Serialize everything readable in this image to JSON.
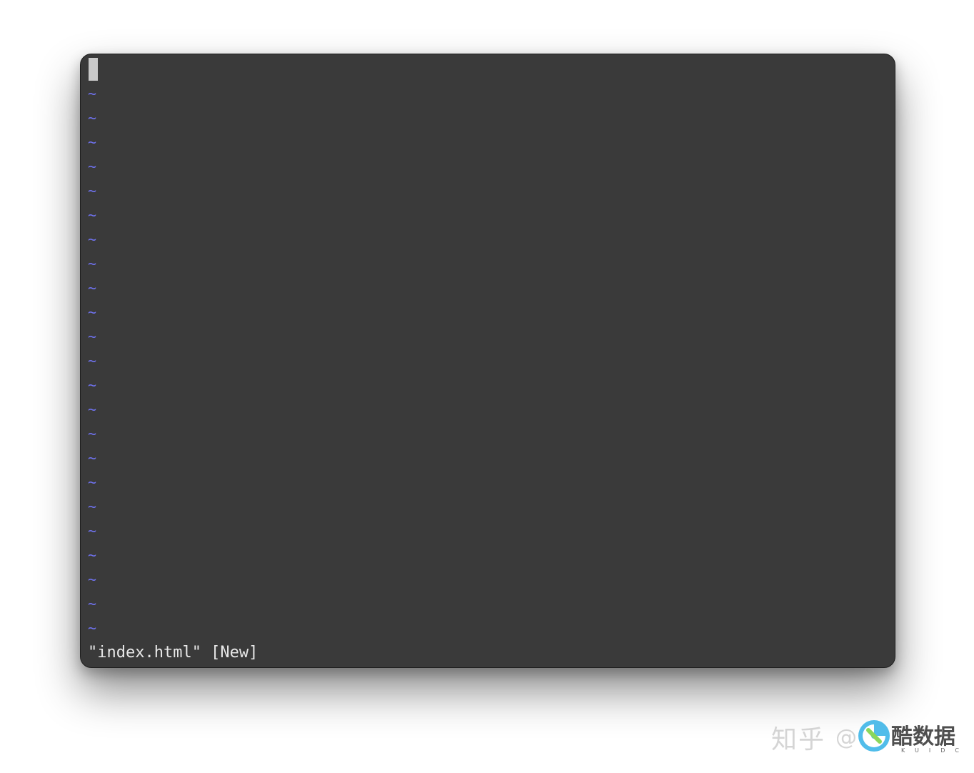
{
  "editor": {
    "empty_line_marker": "~",
    "status_message": "\"index.html\" [New]"
  },
  "watermark": {
    "zhihu_text": "知乎",
    "at_text": "@",
    "brand_name": "酷数据",
    "brand_sub": "KUIDC"
  },
  "colors": {
    "terminal_background": "#3a3a3a",
    "tilde_color": "#6f72ee",
    "status_text": "#e8e8e8",
    "cursor_color": "#c9c9c9"
  },
  "icons": [
    "cursor-block",
    "kuidc-logo-icon"
  ]
}
